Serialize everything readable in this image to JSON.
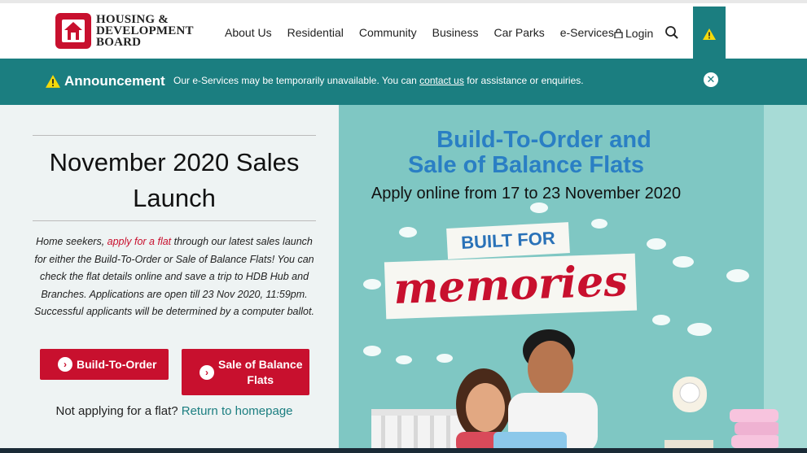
{
  "header": {
    "logo_line1": "HOUSING &",
    "logo_line2": "DEVELOPMENT",
    "logo_line3": "BOARD",
    "nav": [
      "About Us",
      "Residential",
      "Community",
      "Business",
      "Car Parks",
      "e-Services"
    ],
    "login_label": "Login"
  },
  "announcement": {
    "title": "Announcement",
    "message_pre": "Our e-Services may be temporarily unavailable. You can ",
    "message_link": "contact us",
    "message_post": " for assistance or enquiries."
  },
  "hero": {
    "title_line1": "November 2020 Sales",
    "title_line2": "Launch",
    "body_pre": "Home seekers, ",
    "body_link": "apply for a flat",
    "body_post": " through our latest sales launch for either the Build-To-Order or Sale of Balance Flats! You can check the flat details online and save a trip to HDB Hub and Branches. Applications are open till 23 Nov 2020, 11:59pm. Successful applicants will be determined by a computer ballot.",
    "btn_bto": "Build-To-Order",
    "btn_sbf_line1": "Sale of Balance",
    "btn_sbf_line2": "Flats",
    "not_applying": "Not applying for a flat?",
    "return_link": "Return to homepage"
  },
  "banner": {
    "title_line1": "Build-To-Order and",
    "title_line2": "Sale of Balance Flats",
    "subtitle": "Apply online from 17 to 23 November 2020",
    "tag_built": "BUILT FOR",
    "tag_memories": "memories"
  },
  "colors": {
    "teal": "#1b7e80",
    "red": "#c8102e",
    "banner_blue": "#2a7fc4"
  }
}
